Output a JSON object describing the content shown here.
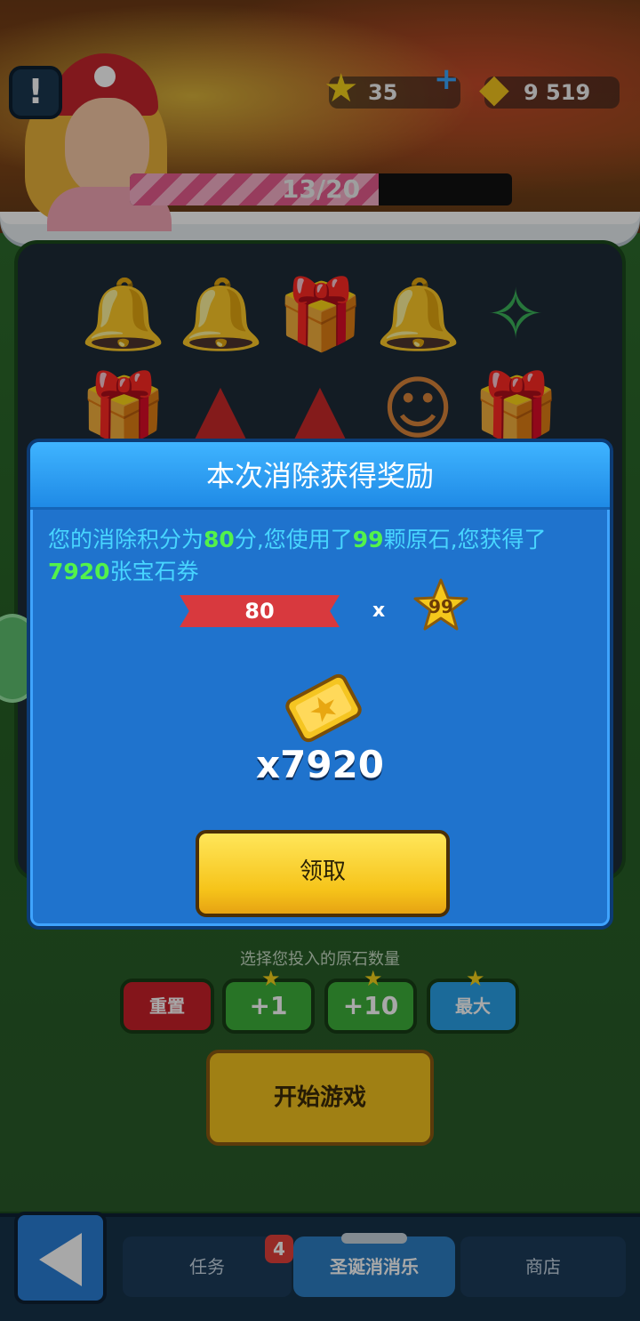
{
  "hud": {
    "alert_icon": "!",
    "stars": "35",
    "gem_tickets": "9 519",
    "progress_text": "13/20",
    "progress_fraction": 0.65
  },
  "board": {
    "row1": [
      "bell",
      "bell",
      "gift-box",
      "bell",
      "candy-cane"
    ],
    "row2": [
      "gift-box",
      "santa-hat",
      "santa-hat",
      "gingerbread",
      "gift-box"
    ]
  },
  "modal": {
    "title": "本次消除获得奖励",
    "text_pre": "您的消除积分为",
    "score": "80",
    "text_mid1": "分,您使用了",
    "stones": "99",
    "text_mid2": "颗原石,您获得了",
    "reward": "7920",
    "text_post": "张宝石券",
    "ribbon_value": "80",
    "times": "x",
    "star_value": "99",
    "reward_amount": "x7920",
    "claim_label": "领取"
  },
  "controls": {
    "hint": "选择您投入的原石数量",
    "reset_label": "重置",
    "plus1_label": "+1",
    "plus10_label": "+10",
    "max_label": "最大",
    "start_label": "开始游戏"
  },
  "nav": {
    "tasks_label": "任务",
    "tasks_badge": "4",
    "xmas_label": "圣诞消消乐",
    "shop_label": "商店"
  },
  "colors": {
    "modal_bg": "#1f73cd",
    "highlight_green": "#53f24a",
    "body_text_cyan": "#48d6ff",
    "claim_yellow": "#f6c41a"
  }
}
